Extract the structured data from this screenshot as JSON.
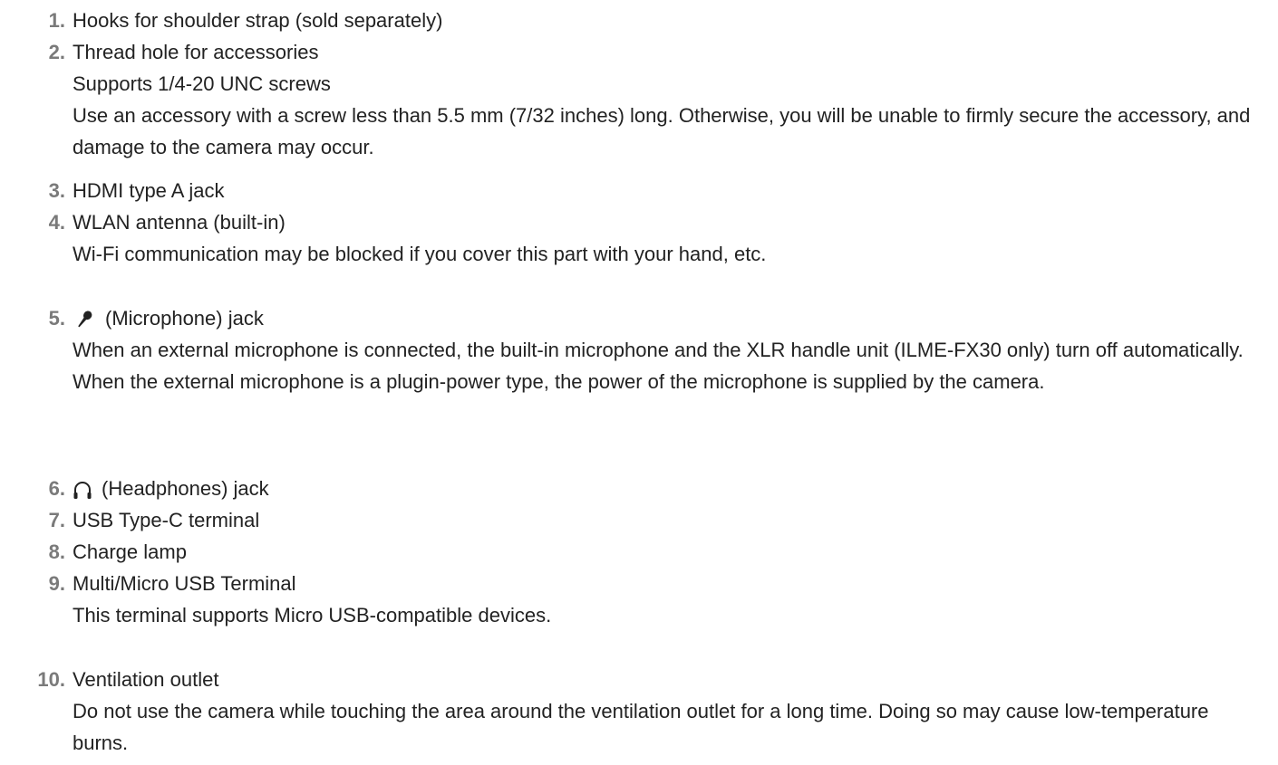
{
  "items": [
    {
      "number": "1.",
      "title": "Hooks for shoulder strap (sold separately)"
    },
    {
      "number": "2.",
      "title": "Thread hole for accessories",
      "desc": [
        "Supports 1/4-20 UNC screws",
        "Use an accessory with a screw less than 5.5 mm (7/32 inches) long. Otherwise, you will be unable to firmly secure the accessory, and damage to the camera may occur."
      ]
    },
    {
      "number": "3.",
      "title": "HDMI type A jack"
    },
    {
      "number": "4.",
      "title": "WLAN antenna (built-in)",
      "desc": [
        "Wi-Fi communication may be blocked if you cover this part with your hand, etc."
      ]
    },
    {
      "number": "5.",
      "title": "(Microphone) jack",
      "icon": "microphone-icon",
      "desc": [
        "When an external microphone is connected, the built-in microphone and the XLR handle unit (ILME-FX30 only) turn off automatically. When the external microphone is a plugin-power type, the power of the microphone is supplied by the camera."
      ]
    },
    {
      "number": "6.",
      "title": "(Headphones) jack",
      "icon": "headphones-icon"
    },
    {
      "number": "7.",
      "title": "USB Type-C terminal"
    },
    {
      "number": "8.",
      "title": "Charge lamp"
    },
    {
      "number": "9.",
      "title": "Multi/Micro USB Terminal",
      "desc": [
        "This terminal supports Micro USB-compatible devices."
      ]
    },
    {
      "number": "10.",
      "title": "Ventilation outlet",
      "desc": [
        "Do not use the camera while touching the area around the ventilation outlet for a long time. Doing so may cause low-temperature burns."
      ]
    }
  ]
}
